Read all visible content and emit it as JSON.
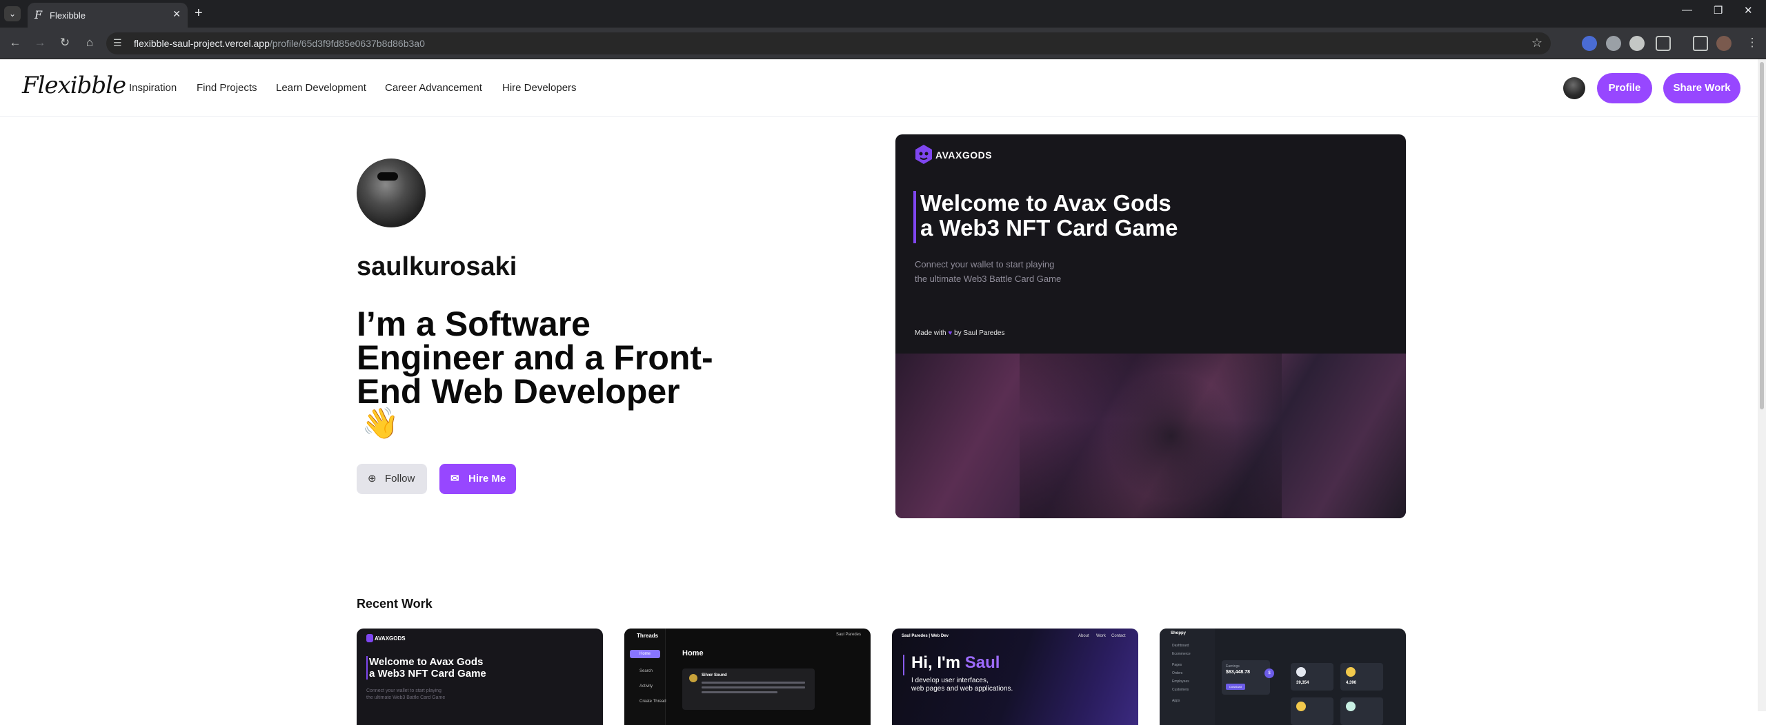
{
  "browser": {
    "tab_title": "Flexibble",
    "url_host": "flexibble-saul-project.vercel.app",
    "url_path": "/profile/65d3f9fd85e0637b8d86b3a0"
  },
  "header": {
    "logo": "Flexibble",
    "nav": [
      "Inspiration",
      "Find Projects",
      "Learn Development",
      "Career Advancement",
      "Hire Developers"
    ],
    "profile_label": "Profile",
    "share_label": "Share Work"
  },
  "profile": {
    "username": "saulkurosaki",
    "headline": "I’m a Software Engineer and a Front-End Web Developer",
    "wave": "👋",
    "follow_label": "Follow",
    "hire_label": "Hire Me"
  },
  "hero": {
    "brand": "AVAXGODS",
    "title_line1": "Welcome to Avax Gods",
    "title_line2": "a Web3 NFT Card Game",
    "subtitle_line1": "Connect your wallet to start playing",
    "subtitle_line2": "the ultimate Web3 Battle Card Game",
    "made_with": "Made with",
    "made_by": "by Saul Paredes"
  },
  "recent": {
    "title": "Recent Work",
    "cards": {
      "avax": {
        "brand": "AVAXGODS",
        "title_line1": "Welcome to Avax Gods",
        "title_line2": "a Web3 NFT Card Game",
        "sub_line1": "Connect your wallet to start playing",
        "sub_line2": "the ultimate Web3 Battle Card Game"
      },
      "threads": {
        "brand": "Threads",
        "menu": [
          "Home",
          "Search",
          "Activity",
          "Create Thread"
        ],
        "heading": "Home",
        "post_author": "Silver Sound",
        "top_user": "Saul Paredes"
      },
      "portfolio": {
        "brand": "Saul Paredes | Web Dev",
        "menu": [
          "About",
          "Work",
          "Contact"
        ],
        "greeting": "Hi, I'm",
        "name": "Saul",
        "desc_line1": "I develop user interfaces,",
        "desc_line2": "web pages and web applications."
      },
      "shoppy": {
        "brand": "Shoppy",
        "menu": [
          "Dashboard",
          "Ecommerce",
          "Pages",
          "Orders",
          "Employees",
          "Customers",
          "Apps"
        ],
        "earnings_label": "Earnings",
        "earnings_value": "$63,448.78",
        "download_label": "Download",
        "coins": [
          "39,354",
          "4,396"
        ]
      }
    }
  }
}
